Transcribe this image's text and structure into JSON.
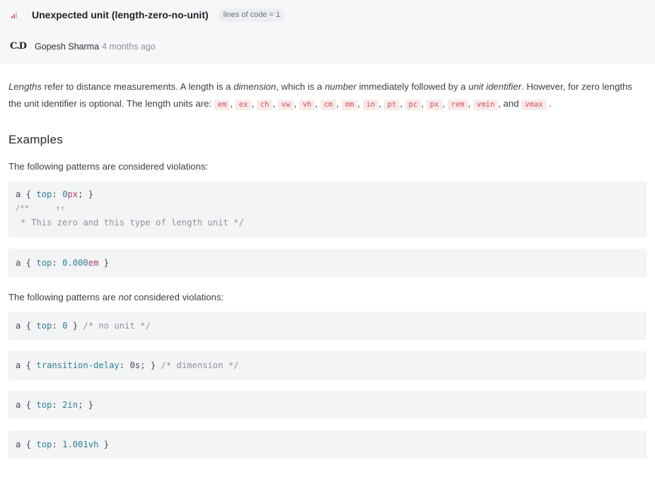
{
  "header": {
    "title": "Unexpected unit (length-zero-no-unit)",
    "loc_badge": "lines of code = 1",
    "avatar_initials": "C.D",
    "author": "Gopesh Sharma",
    "time_ago": "4 months ago"
  },
  "intro": {
    "t1": "Lengths",
    "t2": " refer to distance measurements. A length is a ",
    "t3": "dimension",
    "t4": ", which is a ",
    "t5": "number",
    "t6": " immediately followed by a ",
    "t7": "unit identifier",
    "t8": ". However, for zero lengths the unit identifier is optional. The length units are: ",
    "units": [
      "em",
      "ex",
      "ch",
      "vw",
      "vh",
      "cm",
      "mm",
      "in",
      "pt",
      "pc",
      "px",
      "rem",
      "vmin",
      "vmax"
    ],
    "and": ", and ",
    "end": "."
  },
  "examples": {
    "heading": "Examples",
    "violations_lead": "The following patterns are considered violations:",
    "nonviolations_lead_a": "The following patterns are ",
    "nonviolations_lead_not": "not",
    "nonviolations_lead_b": " considered violations:",
    "v1": {
      "sel": "a { ",
      "prop": "top",
      "colon": ": ",
      "num": "0",
      "unit": "px",
      "end": "; }",
      "line2": "/**      ↑↑",
      "line3": " * This zero and this type of length unit */"
    },
    "v2": {
      "sel": "a { ",
      "prop": "top",
      "colon": ": ",
      "num": "0.000",
      "unit": "em",
      "end": " }"
    },
    "n1": {
      "sel": "a { ",
      "prop": "top",
      "colon": ": ",
      "num": "0",
      "end": " } ",
      "cmt": "/* no unit */"
    },
    "n2": {
      "sel": "a { ",
      "prop": "transition-delay",
      "colon": ": ",
      "val": "0s",
      "end": "; } ",
      "cmt": "/* dimension */"
    },
    "n3": {
      "sel": "a { ",
      "prop": "top",
      "colon": ": ",
      "val": "2in",
      "end": "; }"
    },
    "n4": {
      "sel": "a { ",
      "prop": "top",
      "colon": ": ",
      "val": "1.001vh",
      "end": " }"
    }
  },
  "colors": {
    "severity_bars": "#e06060",
    "unit_chip_text": "#d34f56",
    "property": "#2f7e9a"
  }
}
